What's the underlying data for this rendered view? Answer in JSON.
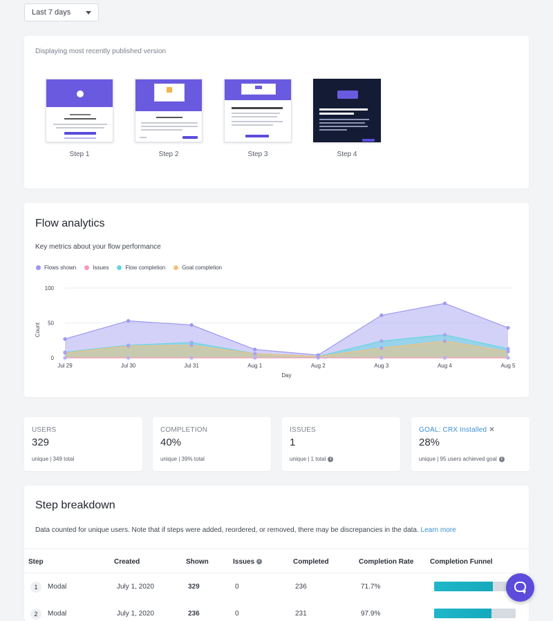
{
  "range": {
    "selected": "Last 7 days"
  },
  "preview": {
    "caption": "Displaying most recently published version",
    "steps": [
      {
        "label": "Step 1",
        "thumb_text": [
          "Hi there!",
          "Welcome to Appcues!"
        ]
      },
      {
        "label": "Step 2",
        "thumb_text": [
          "Make a big impact with modals"
        ]
      },
      {
        "label": "Step 3",
        "thumb_text": [
          "Strike a balance with slideouts"
        ]
      },
      {
        "label": "Step 4",
        "thumb_text": [
          "Give contextual guidance with tooltips"
        ]
      }
    ]
  },
  "analytics": {
    "title": "Flow analytics",
    "subtitle": "Key metrics about your flow performance",
    "legend": [
      {
        "name": "Flows shown",
        "color": "#9d98f0"
      },
      {
        "name": "Issues",
        "color": "#f29bb6"
      },
      {
        "name": "Flow completion",
        "color": "#66d6e0"
      },
      {
        "name": "Goal completion",
        "color": "#f1c27d"
      }
    ]
  },
  "chart_data": {
    "type": "area",
    "title": "",
    "xlabel": "Day",
    "ylabel": "Count",
    "ylim": [
      0,
      100
    ],
    "yticks": [
      0,
      50,
      100
    ],
    "grid": true,
    "legend": "top-left",
    "categories": [
      "Jul 29",
      "Jul 30",
      "Jul 31",
      "Aug 1",
      "Aug 2",
      "Aug 3",
      "Aug 4",
      "Aug 5"
    ],
    "series": [
      {
        "name": "Flows shown",
        "color": "#9d98f0",
        "values": [
          27,
          53,
          47,
          12,
          4,
          61,
          78,
          43
        ]
      },
      {
        "name": "Issues",
        "color": "#f29bb6",
        "values": [
          0,
          0,
          0,
          0,
          0,
          0,
          0,
          0
        ]
      },
      {
        "name": "Flow completion",
        "color": "#66d6e0",
        "values": [
          8,
          18,
          22,
          6,
          2,
          24,
          33,
          13
        ]
      },
      {
        "name": "Goal completion",
        "color": "#f1c27d",
        "values": [
          7,
          17,
          18,
          6,
          2,
          14,
          24,
          9
        ]
      }
    ]
  },
  "stats": [
    {
      "label": "USERS",
      "value": "329",
      "sub": "unique | 349 total",
      "info": false
    },
    {
      "label": "COMPLETION",
      "value": "40%",
      "sub": "unique | 39% total",
      "info": false
    },
    {
      "label": "ISSUES",
      "value": "1",
      "sub": "unique | 1 total",
      "info": true
    },
    {
      "label": "GOAL: CRX Installed",
      "value": "28%",
      "sub": "unique | 95 users achieved goal",
      "info": true,
      "goal": true
    }
  ],
  "breakdown": {
    "title": "Step breakdown",
    "subtitle": "Data counted for unique users. Note that if steps were added, reordered, or removed, there may be discrepancies in the data.",
    "learn_more": "Learn more",
    "columns": [
      "Step",
      "Created",
      "Shown",
      "Issues",
      "Completed",
      "Completion Rate",
      "Completion Funnel"
    ],
    "rows": [
      {
        "num": "1",
        "type": "Modal",
        "created": "July 1, 2020",
        "shown": "329",
        "issues": "0",
        "completed": "236",
        "rate": "71.7%",
        "funnel": 0.72
      },
      {
        "num": "2",
        "type": "Modal",
        "created": "July 1, 2020",
        "shown": "236",
        "issues": "0",
        "completed": "231",
        "rate": "97.9%",
        "funnel": 0.7
      }
    ]
  },
  "colors": {
    "accent": "#5b4cdb",
    "link": "#3a8fd0",
    "funnel": "#1fb7c9"
  }
}
